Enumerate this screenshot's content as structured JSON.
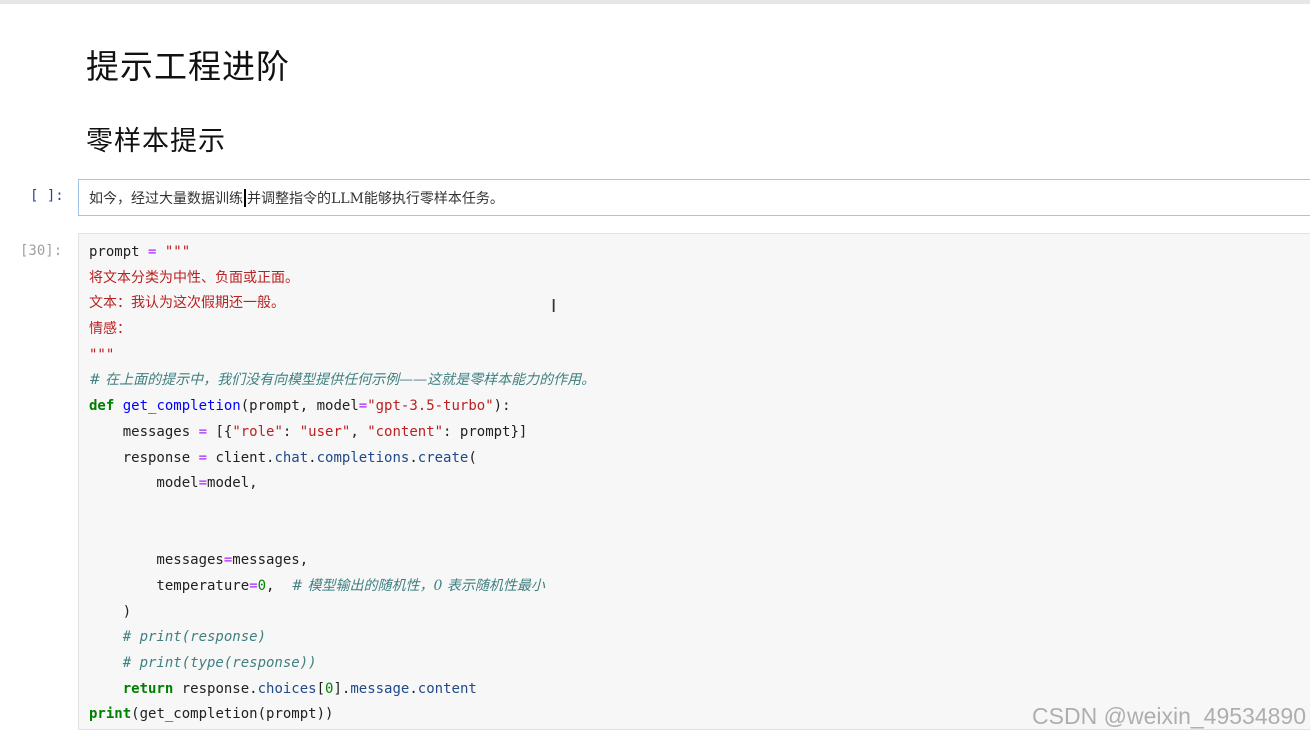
{
  "headings": {
    "h1": "提示工程进阶",
    "h2": "零样本提示"
  },
  "cells": {
    "markdown": {
      "prompt": "[ ]:",
      "text_before_cursor": "如今，经过大量数据训练",
      "text_after_cursor": "并调整指令的LLM能够执行零样本任务。"
    },
    "code": {
      "prompt": "[30]:",
      "lines": {
        "l1_var": "prompt",
        "l1_op": " = ",
        "l1_str": "\"\"\"",
        "l2": "将文本分类为中性、负面或正面。",
        "l3": "文本：我认为这次假期还一般。",
        "l4": "情感：",
        "l5": "\"\"\"",
        "l6": "# 在上面的提示中，我们没有向模型提供任何示例——这就是零样本能力的作用。",
        "l7_kw": "def",
        "l7_fn": "get_completion",
        "l7_a": "(prompt, model",
        "l7_eq": "=",
        "l7_str": "\"gpt-3.5-turbo\"",
        "l7_b": "):",
        "l8_a": "    messages ",
        "l8_eq": "=",
        "l8_b": " [{",
        "l8_s1": "\"role\"",
        "l8_c": ": ",
        "l8_s2": "\"user\"",
        "l8_d": ", ",
        "l8_s3": "\"content\"",
        "l8_e": ": prompt}]",
        "l9_a": "    response ",
        "l9_eq": "=",
        "l9_b": " client.",
        "l9_chat": "chat",
        "l9_dot1": ".",
        "l9_comp": "completions",
        "l9_dot2": ".",
        "l9_create": "create",
        "l9_c": "(",
        "l10_a": "        model",
        "l10_eq": "=",
        "l10_b": "model,",
        "l13_a": "        messages",
        "l13_eq": "=",
        "l13_b": "messages,",
        "l14_a": "        temperature",
        "l14_eq": "=",
        "l14_num": "0",
        "l14_b": ",  ",
        "l14_cmt": "# 模型输出的随机性，0 表示随机性最小",
        "l15": "    )",
        "l16": "    # print(response)",
        "l17": "    # print(type(response))",
        "l18_kw": "    return",
        "l18_a": " response.",
        "l18_choices": "choices",
        "l18_b": "[",
        "l18_num": "0",
        "l18_c": "].",
        "l18_msg": "message",
        "l18_dot": ".",
        "l18_content": "content",
        "l19_fn": "print",
        "l19_a": "(get_completion(prompt))"
      }
    }
  },
  "watermark": "CSDN @weixin_49534890",
  "icons": {
    "text_cursor": "I"
  }
}
